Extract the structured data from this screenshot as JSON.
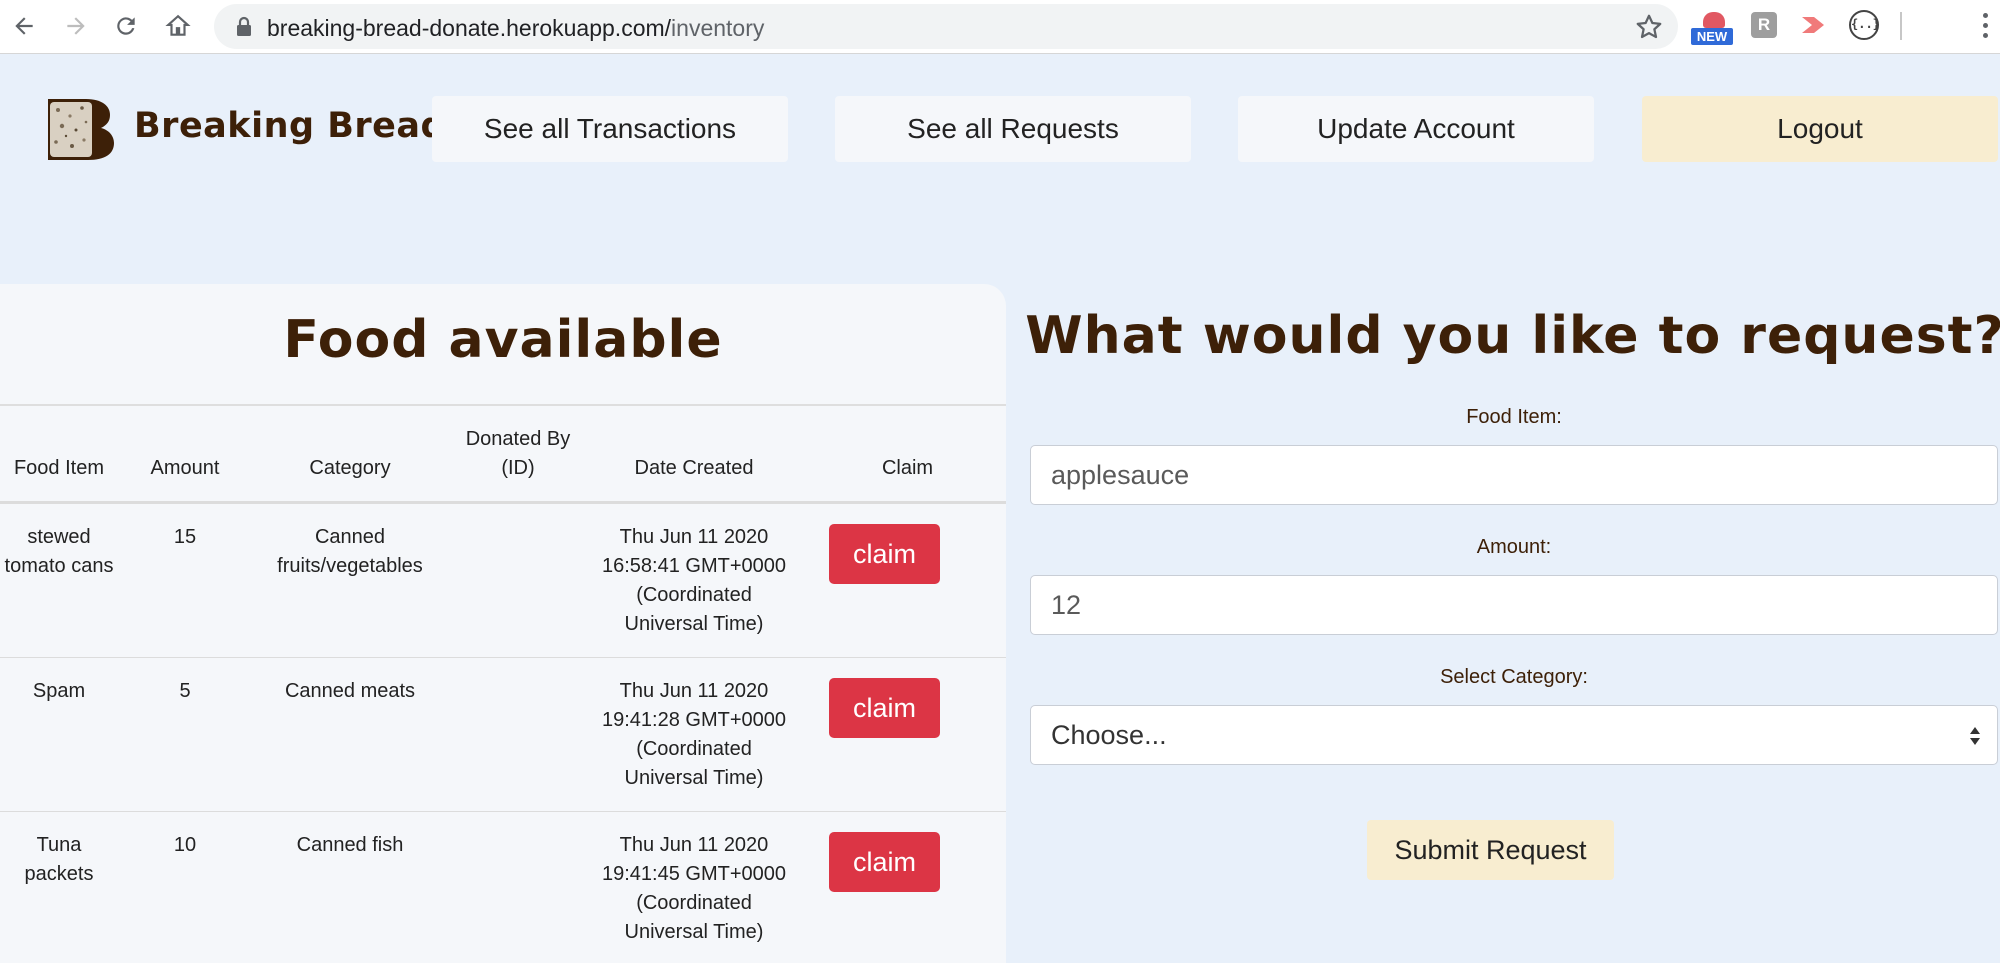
{
  "browser": {
    "url_domain": "breaking-bread-donate.herokuapp.com/",
    "url_path": "inventory",
    "extension_new_badge": "NEW",
    "extension_r_label": "R",
    "extension_code_label": "{..}"
  },
  "header": {
    "brand": "Breaking Bread",
    "logo_letter": "B",
    "nav": {
      "transactions": "See all Transactions",
      "requests": "See all Requests",
      "account": "Update Account",
      "logout": "Logout"
    }
  },
  "food": {
    "title": "Food available",
    "columns": [
      "Food Item",
      "Amount",
      "Category",
      "Donated By (ID)",
      "Date Created",
      "Claim"
    ],
    "rows": [
      {
        "item": "stewed tomato cans",
        "amount": "15",
        "category": "Canned fruits/vegetables",
        "donated_by": "",
        "date": "Thu Jun 11 2020 16:58:41 GMT+0000 (Coordinated Universal Time)",
        "claim": "claim"
      },
      {
        "item": "Spam",
        "amount": "5",
        "category": "Canned meats",
        "donated_by": "",
        "date": "Thu Jun 11 2020 19:41:28 GMT+0000 (Coordinated Universal Time)",
        "claim": "claim"
      },
      {
        "item": "Tuna packets",
        "amount": "10",
        "category": "Canned fish",
        "donated_by": "",
        "date": "Thu Jun 11 2020 19:41:45 GMT+0000 (Coordinated Universal Time)",
        "claim": "claim"
      }
    ]
  },
  "request_form": {
    "title": "What would you like to request?",
    "food_item_label": "Food Item:",
    "food_item_value": "applesauce",
    "amount_label": "Amount:",
    "amount_value": "12",
    "category_label": "Select Category:",
    "category_selected": "Choose...",
    "submit_label": "Submit Request"
  },
  "colors": {
    "page_bg": "#e8f0fa",
    "panel_bg": "#f5f7fa",
    "brand_brown": "#3d2008",
    "claim_red": "#dc3545",
    "logout_cream": "#f8edd0"
  }
}
